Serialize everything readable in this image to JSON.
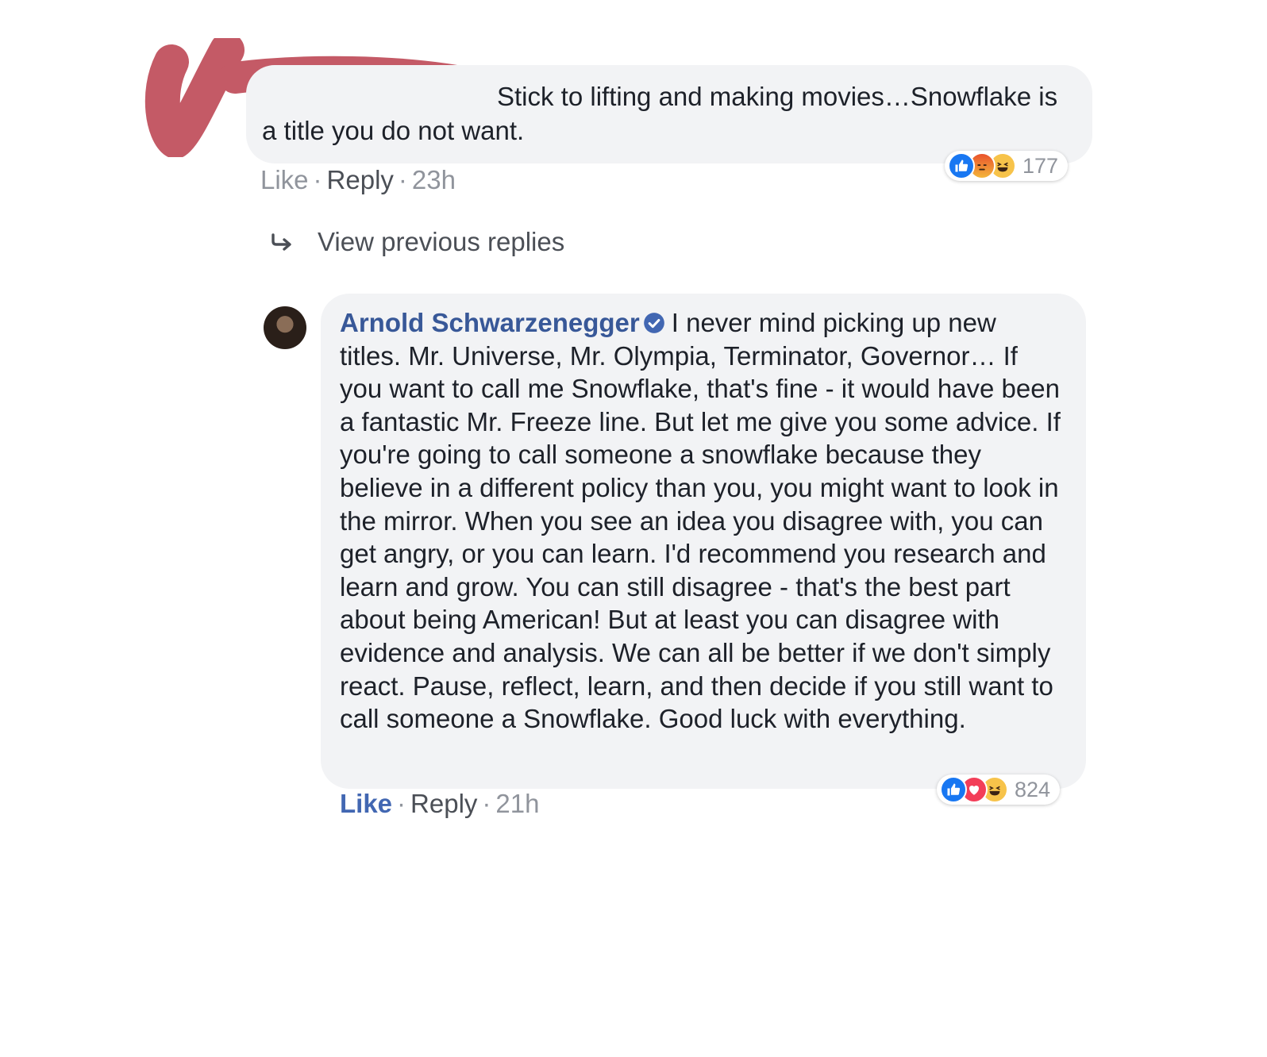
{
  "comment": {
    "text": "Stick to lifting and making movies…Snowflake is a title you do not want.",
    "actions": {
      "like": "Like",
      "reply": "Reply",
      "time": "23h"
    },
    "reactions": {
      "icons": [
        "like-icon",
        "angry-icon",
        "haha-icon"
      ],
      "count": "177"
    }
  },
  "view_replies": {
    "label": "View previous replies",
    "icon": "reply-arrow-icon"
  },
  "reply": {
    "author": "Arnold Schwarzenegger",
    "verified_icon": "verified-badge-icon",
    "text": "I never mind picking up new titles. Mr. Universe, Mr. Olympia, Terminator, Governor… If you want to call me Snowflake, that's fine - it would have been a fantastic Mr. Freeze line. But let me give you some advice. If you're going to call someone a snowflake because they believe in a different policy than you, you might want to look in the mirror. When you see an idea you disagree with, you can get angry, or you can learn. I'd recommend you research and learn and grow. You can still disagree - that's the best part about being American! But at least you can disagree with evidence and analysis. We can all be better if we don't simply react. Pause, reflect, learn, and then decide if you still want to call someone a Snowflake. Good luck with everything.",
    "actions": {
      "like": "Like",
      "reply": "Reply",
      "time": "21h"
    },
    "reactions": {
      "icons": [
        "like-icon",
        "love-icon",
        "haha-icon"
      ],
      "count": "824"
    }
  },
  "colors": {
    "bubble": "#f2f3f5",
    "author_link": "#385898",
    "meta_gray": "#90949c",
    "redaction": "#c45a66"
  }
}
